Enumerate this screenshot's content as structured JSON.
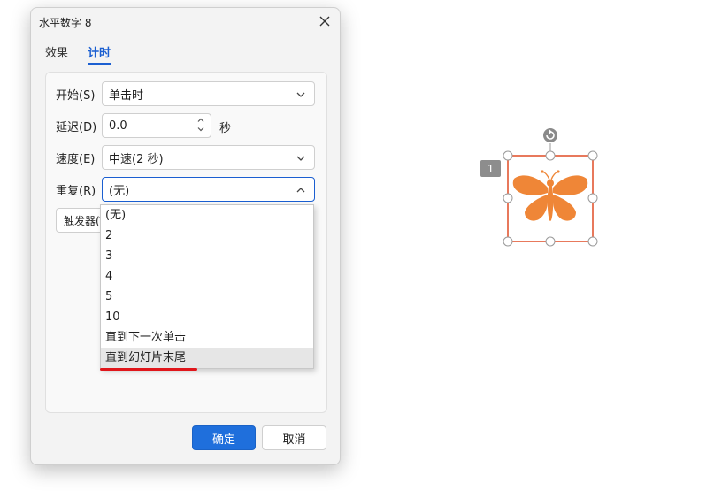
{
  "dialog": {
    "title": "水平数字 8",
    "tabs": [
      {
        "label": "效果",
        "active": false
      },
      {
        "label": "计时",
        "active": true
      }
    ],
    "start": {
      "label": "开始(S)",
      "value": "单击时"
    },
    "delay": {
      "label": "延迟(D)",
      "value": "0.0",
      "unit": "秒"
    },
    "speed": {
      "label": "速度(E)",
      "value": "中速(2 秒)"
    },
    "repeat": {
      "label": "重复(R)",
      "value": "(无)"
    },
    "trigger_label": "触发器(T)",
    "repeat_options": [
      "(无)",
      "2",
      "3",
      "4",
      "5",
      "10",
      "直到下一次单击",
      "直到幻灯片末尾"
    ],
    "highlighted_option": "直到幻灯片末尾",
    "ok_label": "确定",
    "cancel_label": "取消"
  },
  "slide": {
    "badge": "1",
    "object_icon": "butterfly-icon",
    "object_color": "#ef8637",
    "selection_color": "#e8795c"
  },
  "colors": {
    "accent": "#1b5fd1",
    "primary_button": "#1f6fdc",
    "annotation_line": "#e0161b"
  }
}
